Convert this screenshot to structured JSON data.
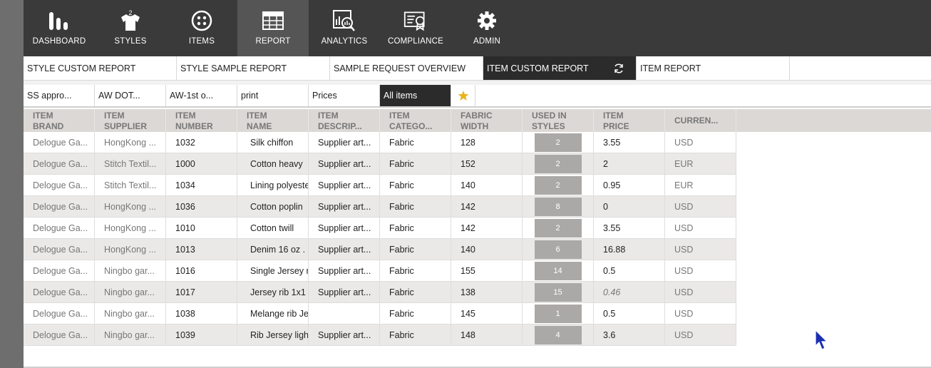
{
  "nav": {
    "items": [
      {
        "label": "DASHBOARD",
        "icon": "dashboard-bars-icon"
      },
      {
        "label": "STYLES",
        "icon": "tshirt-icon"
      },
      {
        "label": "ITEMS",
        "icon": "button-icon"
      },
      {
        "label": "REPORT",
        "icon": "table-grid-icon"
      },
      {
        "label": "ANALYTICS",
        "icon": "analytics-magnifier-icon"
      },
      {
        "label": "COMPLIANCE",
        "icon": "certificate-icon"
      },
      {
        "label": "ADMIN",
        "icon": "gear-icon"
      }
    ],
    "active": "REPORT"
  },
  "tabs": [
    {
      "label": "STYLE CUSTOM REPORT"
    },
    {
      "label": "STYLE SAMPLE REPORT"
    },
    {
      "label": "SAMPLE REQUEST OVERVIEW"
    },
    {
      "label": "ITEM CUSTOM REPORT"
    },
    {
      "label": "ITEM REPORT"
    }
  ],
  "views": [
    {
      "label": "SS appro..."
    },
    {
      "label": "AW DOT..."
    },
    {
      "label": "AW-1st o..."
    },
    {
      "label": "print"
    },
    {
      "label": "Prices"
    },
    {
      "label": "All items"
    }
  ],
  "table": {
    "headers": [
      {
        "line1": "ITEM",
        "line2": "BRAND"
      },
      {
        "line1": "ITEM",
        "line2": "SUPPLIER"
      },
      {
        "line1": "ITEM",
        "line2": "NUMBER"
      },
      {
        "line1": "ITEM",
        "line2": "NAME"
      },
      {
        "line1": "ITEM",
        "line2": "DESCRIP..."
      },
      {
        "line1": "ITEM",
        "line2": "CATEGO..."
      },
      {
        "line1": "FABRIC",
        "line2": "WIDTH"
      },
      {
        "line1": "USED IN",
        "line2": "STYLES"
      },
      {
        "line1": "ITEM",
        "line2": "PRICE"
      },
      {
        "line1": "CURREN...",
        "line2": ""
      }
    ],
    "rows": [
      {
        "brand": "Delogue Ga...",
        "supplier": "HongKong ...",
        "number": "1032",
        "name": "Silk chiffon",
        "description": "Supplier art...",
        "category": "Fabric",
        "width": "128",
        "used": "2",
        "price": "3.55",
        "currency": "USD"
      },
      {
        "brand": "Delogue Ga...",
        "supplier": "Stitch Textil...",
        "number": "1000",
        "name": "Cotton heavy",
        "description": "Supplier art...",
        "category": "Fabric",
        "width": "152",
        "used": "2",
        "price": "2",
        "currency": "EUR"
      },
      {
        "brand": "Delogue Ga...",
        "supplier": "Stitch Textil...",
        "number": "1034",
        "name": "Lining polyeste",
        "description": "Supplier art...",
        "category": "Fabric",
        "width": "140",
        "used": "2",
        "price": "0.95",
        "currency": "EUR"
      },
      {
        "brand": "Delogue Ga...",
        "supplier": "HongKong ...",
        "number": "1036",
        "name": "Cotton poplin",
        "description": "Supplier art...",
        "category": "Fabric",
        "width": "142",
        "used": "8",
        "price": "0",
        "currency": "USD"
      },
      {
        "brand": "Delogue Ga...",
        "supplier": "HongKong ...",
        "number": "1010",
        "name": "Cotton twill",
        "description": "Supplier art...",
        "category": "Fabric",
        "width": "142",
        "used": "2",
        "price": "3.55",
        "currency": "USD"
      },
      {
        "brand": "Delogue Ga...",
        "supplier": "HongKong ...",
        "number": "1013",
        "name": "Denim 16 oz  .",
        "description": "Supplier art...",
        "category": "Fabric",
        "width": "140",
        "used": "6",
        "price": "16.88",
        "currency": "USD"
      },
      {
        "brand": "Delogue Ga...",
        "supplier": "Ningbo gar...",
        "number": "1016",
        "name": "Single Jersey m",
        "description": "Supplier art...",
        "category": "Fabric",
        "width": "155",
        "used": "14",
        "price": "0.5",
        "currency": "USD"
      },
      {
        "brand": "Delogue Ga...",
        "supplier": "Ningbo gar...",
        "number": "1017",
        "name": "Jersey rib 1x1",
        "description": "Supplier art...",
        "category": "Fabric",
        "width": "138",
        "used": "15",
        "price": "0.46",
        "currency": "USD"
      },
      {
        "brand": "Delogue Ga...",
        "supplier": "Ningbo gar...",
        "number": "1038",
        "name": "Melange rib Je",
        "description": "",
        "category": "Fabric",
        "width": "145",
        "used": "1",
        "price": "0.5",
        "currency": "USD"
      },
      {
        "brand": "Delogue Ga...",
        "supplier": "Ningbo gar...",
        "number": "1039",
        "name": "Rib Jersey light",
        "description": "Supplier art...",
        "category": "Fabric",
        "width": "148",
        "used": "4",
        "price": "3.6",
        "currency": "USD"
      }
    ]
  },
  "colors": {
    "nav_bg": "#3a3a3a",
    "nav_active": "#555555",
    "tab_active": "#2b2b2b",
    "header_bg": "#dcd8d5",
    "row_alt": "#ebe9e7",
    "badge": "#aba9a7",
    "star": "#e6b422"
  }
}
